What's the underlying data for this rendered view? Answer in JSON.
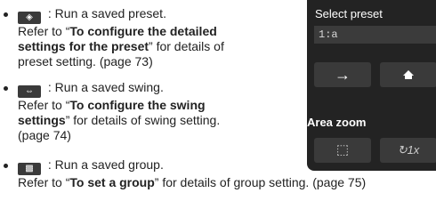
{
  "items": [
    {
      "icon": "preset-icon",
      "line1": " : Run a saved preset.",
      "line2_pre": "Refer to “",
      "line2_bold": "To configure the detailed",
      "line3_bold": "settings for the preset",
      "line3_post": "” for details of",
      "line4": "preset setting. (page 73)"
    },
    {
      "icon": "swing-icon",
      "line1": " : Run a saved swing.",
      "line2_pre": "Refer to “",
      "line2_bold": "To configure the swing",
      "line3_bold": "settings",
      "line3_post": "” for details of swing setting.",
      "line4": "(page 74)"
    },
    {
      "icon": "group-icon",
      "line1": " : Run a saved group.",
      "line2_pre": "Refer to “",
      "line2_bold": "To set a group",
      "line2_post": "” for details of group setting. (page 75)"
    }
  ],
  "panel": {
    "select_label": "Select preset",
    "preset_value": "1:a",
    "area_label": "Area zoom",
    "zoom_1x_label": "↻1x",
    "zoom_area_glyph": "⬚"
  },
  "colors": {
    "panel_bg": "#232323",
    "button_bg": "#3a3a3a",
    "text": "#222222"
  }
}
